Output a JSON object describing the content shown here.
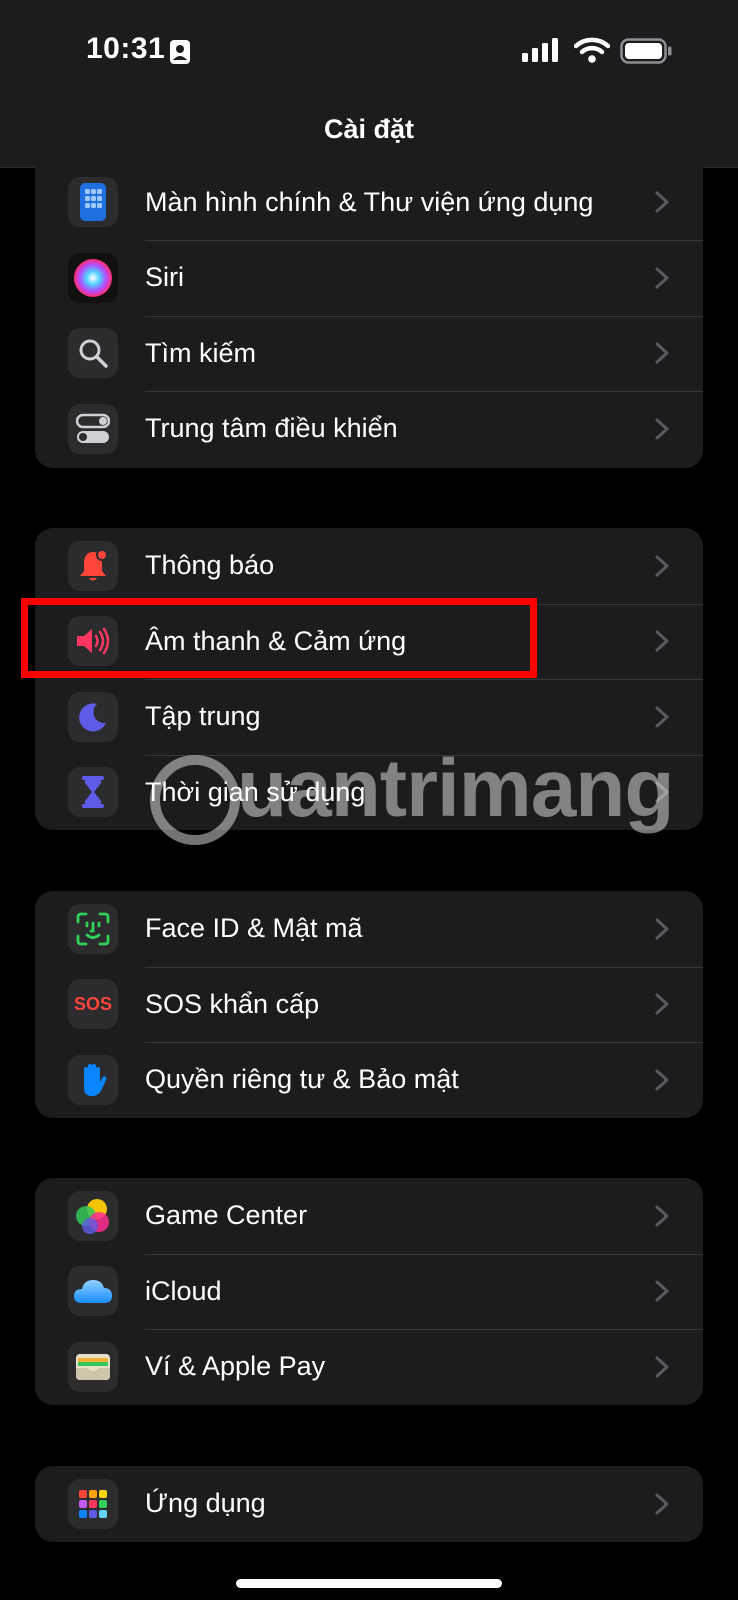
{
  "status": {
    "time": "10:31"
  },
  "nav": {
    "title": "Cài đặt"
  },
  "groups": [
    {
      "items": [
        {
          "label": "Màn hình chính & Thư viện ứng dụng",
          "icon": "home-screen-icon"
        },
        {
          "label": "Siri",
          "icon": "siri-icon"
        },
        {
          "label": "Tìm kiếm",
          "icon": "search-icon"
        },
        {
          "label": "Trung tâm điều khiển",
          "icon": "control-center-icon"
        }
      ]
    },
    {
      "items": [
        {
          "label": "Thông báo",
          "icon": "notification-bell-icon"
        },
        {
          "label": "Âm thanh & Cảm ứng",
          "icon": "speaker-icon"
        },
        {
          "label": "Tập trung",
          "icon": "moon-icon"
        },
        {
          "label": "Thời gian sử dụng",
          "icon": "hourglass-icon"
        }
      ]
    },
    {
      "items": [
        {
          "label": "Face ID & Mật mã",
          "icon": "face-id-icon"
        },
        {
          "label": "SOS khẩn cấp",
          "icon": "sos-icon",
          "icon_text": "SOS"
        },
        {
          "label": "Quyền riêng tư & Bảo mật",
          "icon": "hand-icon"
        }
      ]
    },
    {
      "items": [
        {
          "label": "Game Center",
          "icon": "game-center-icon"
        },
        {
          "label": "iCloud",
          "icon": "cloud-icon"
        },
        {
          "label": "Ví & Apple Pay",
          "icon": "wallet-icon"
        }
      ]
    },
    {
      "items": [
        {
          "label": "Ứng dụng",
          "icon": "apps-grid-icon"
        }
      ]
    }
  ],
  "watermark": "uantrimang",
  "colors": {
    "background": "#000000",
    "cell": "#1c1c1e",
    "separator": "#38383a",
    "highlight": "#ff0000",
    "chevron": "#5a5a5e"
  }
}
